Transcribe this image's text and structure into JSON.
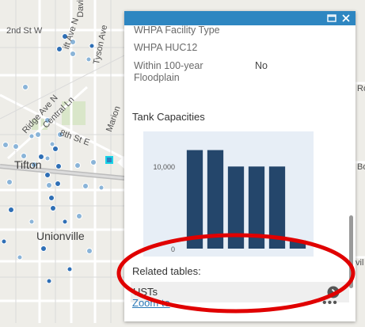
{
  "map": {
    "labels": {
      "second_st": "2nd St W",
      "tyson_ave": "Tyson Ave",
      "davis_ave": "Davis Ave",
      "fifth_ave": "ift Ave N",
      "ridge_ave": "Ridge Ave N",
      "central_ln": "Central Ln",
      "eighth_st": "8th St E",
      "marion": "Marion",
      "tifton": "Tifton",
      "unionville": "Unionville",
      "ro": "Ro",
      "bo": "Bo",
      "vil": "vil"
    }
  },
  "popup": {
    "attributes": [
      {
        "label": "WHPA Facility Type",
        "value": ""
      },
      {
        "label": "WHPA HUC12",
        "value": ""
      },
      {
        "label": "Within 100-year\nFloodplain",
        "value": "No"
      }
    ],
    "tank_capacities_title": "Tank Capacities",
    "related_tables_label": "Related tables:",
    "related_table_item": "USTs",
    "zoom_to": "Zoom to",
    "more": "•••"
  },
  "icons": {
    "maximize": "maximize-icon",
    "close": "close-icon",
    "arrow": "chevron-right-icon",
    "more": "more-icon"
  },
  "colors": {
    "header": "#2e86c1",
    "bar": "#24466b",
    "chart_bg": "#e7eef6",
    "annotation": "#e00000"
  },
  "chart_data": {
    "type": "bar",
    "title": "Tank Capacities",
    "y_tick_labels": [
      "10,000",
      "0"
    ],
    "values": [
      12000,
      12000,
      10000,
      10000,
      10000,
      1000
    ],
    "ylim": [
      0,
      13500
    ],
    "grid": false
  }
}
